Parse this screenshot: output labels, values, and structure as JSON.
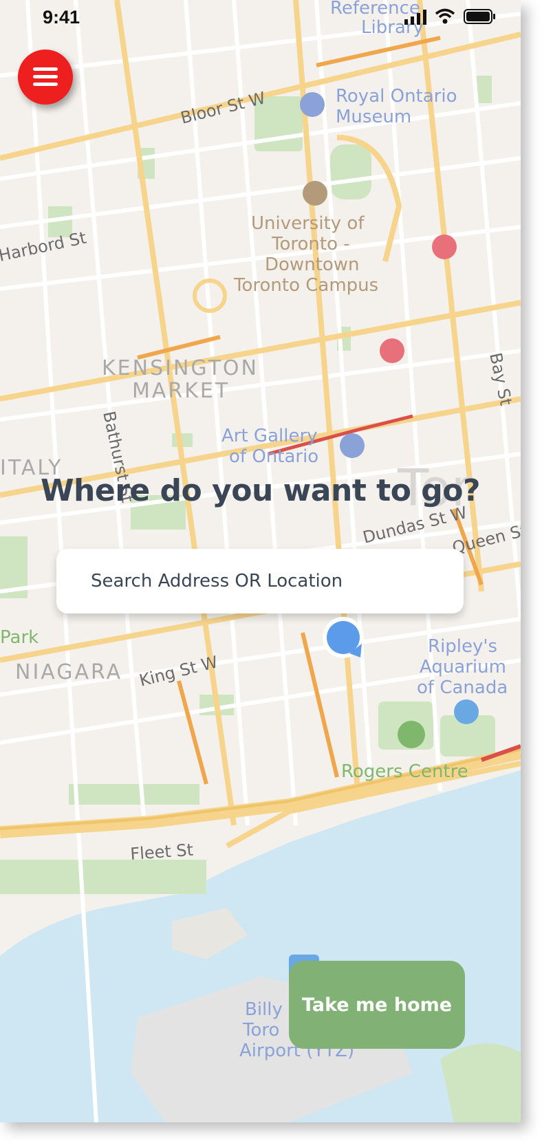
{
  "status_bar": {
    "time": "9:41"
  },
  "map": {
    "streets": [
      "Bloor St W",
      "Harbord St",
      "Bathurst St",
      "King St W",
      "Fleet St",
      "Bay St",
      "Dundas St W",
      "Queen St W"
    ],
    "neighbourhoods": [
      "KENSINGTON",
      "MARKET",
      "ITALY",
      "NIAGARA"
    ],
    "places": [
      "Reference",
      "Library",
      "Royal Ontario",
      "Museum",
      "University of",
      "Toronto -",
      "Downtown",
      "Toronto Campus",
      "Art Gallery",
      "of Ontario",
      "Ripley's",
      "Aquarium",
      "of Canada",
      "Rogers Centre",
      "Billy",
      "Toro",
      "Airport (YTZ)",
      "Park"
    ],
    "city_label": "Tor",
    "colors": {
      "land": "#f4f1ec",
      "water": "#cfe6f3",
      "park": "#cfe5c2",
      "major_road": "#f6d48c",
      "heavy_road": "#f0a64a",
      "traffic": "#d9504a",
      "poi_blue": "#8aa2d8",
      "poi_brown": "#b39a7a",
      "poi_green": "#7fb86c"
    }
  },
  "menu_button": {
    "icon": "hamburger-icon",
    "color": "#ee1f1f"
  },
  "headline": "Where do you want to go?",
  "search": {
    "placeholder": "Search Address OR Location",
    "value": ""
  },
  "current_location": {
    "icon": "location-dot-icon",
    "color": "#5b9bea"
  },
  "home_button": {
    "label": "Take me home",
    "color": "#82b175"
  }
}
